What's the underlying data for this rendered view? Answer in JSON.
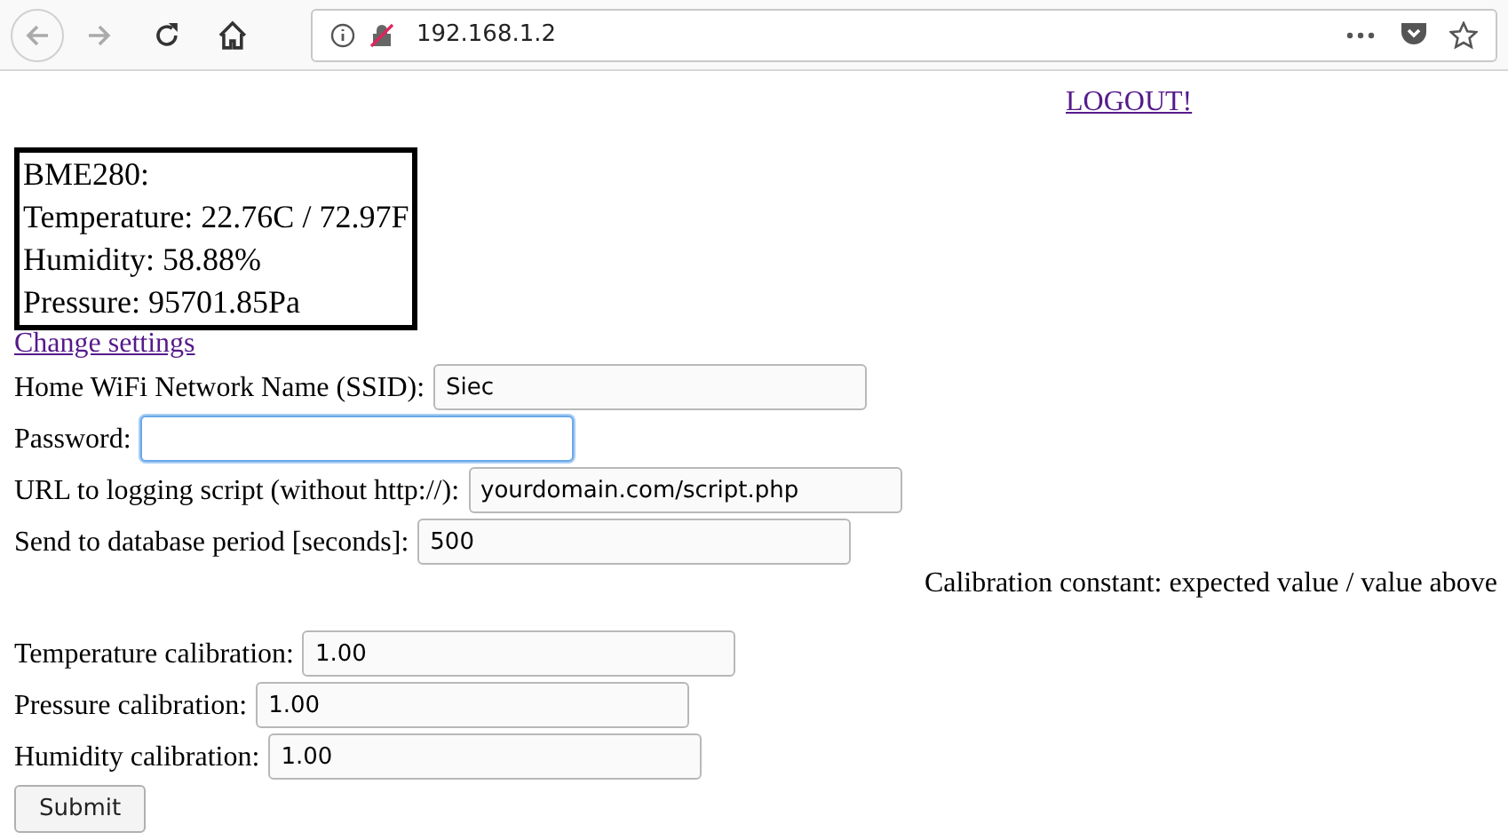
{
  "browser": {
    "url": "192.168.1.2"
  },
  "logout_link": "LOGOUT!",
  "sensor_box": {
    "lines": [
      "BME280:",
      "Temperature: 22.76C / 72.97F",
      "Humidity: 58.88%",
      "Pressure: 95701.85Pa"
    ]
  },
  "change_settings_link": "Change settings",
  "fields": [
    {
      "label": "Home WiFi Network Name (SSID):",
      "value": "Siec",
      "focused": false
    },
    {
      "label": "Password:",
      "focused": true
    },
    {
      "label": "URL to logging script (without http://):",
      "value": "yourdomain.com/script.php",
      "focused": false
    },
    {
      "label": "Send to database period [seconds]:",
      "value": "500",
      "focused": false
    }
  ],
  "calibration_note": "Calibration constant: expected value / value above",
  "calibration_fields": [
    {
      "label": "Temperature calibration:",
      "value": "1.00",
      "focused": false
    },
    {
      "label": "Pressure calibration:",
      "value": "1.00",
      "focused": false
    },
    {
      "label": "Humidity calibration:",
      "value": "1.00",
      "focused": false
    }
  ],
  "submit_button": "Submit"
}
